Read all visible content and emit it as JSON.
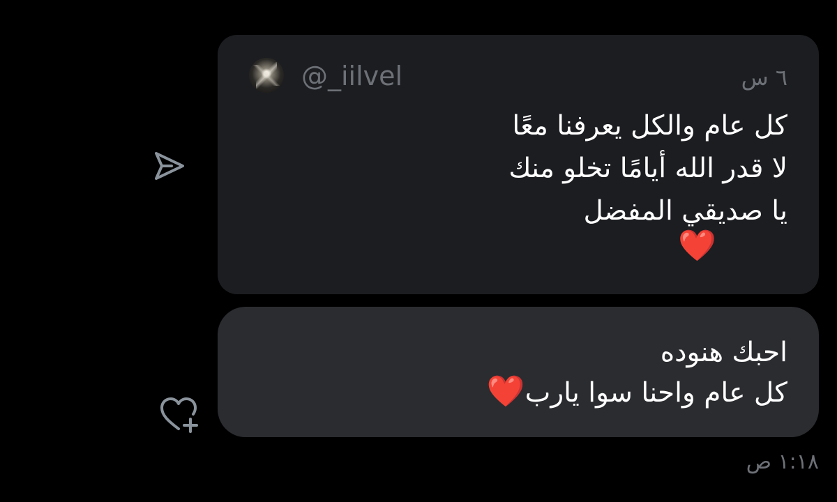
{
  "quoted_post": {
    "handle": "@_iilvel",
    "time": "٦ س",
    "lines": [
      "كل عام والكل يعرفنا معًا",
      "لا قدر الله أيامًا تخلو منك",
      "يا صديقي المفضل"
    ],
    "emoji": "❤️"
  },
  "reply": {
    "lines": [
      "احبك هنوده",
      "كل عام واحنا سوا يارب"
    ],
    "emoji": "❤️"
  },
  "message_time": "١:١٨ ص",
  "icons": {
    "share": "send-icon",
    "react": "heart-plus-icon"
  },
  "colors": {
    "background": "#000000",
    "quoted_card": "#1c1d21",
    "reply_bubble": "#2b2c30",
    "muted_text": "#6d7177",
    "icon": "#8a939c"
  }
}
